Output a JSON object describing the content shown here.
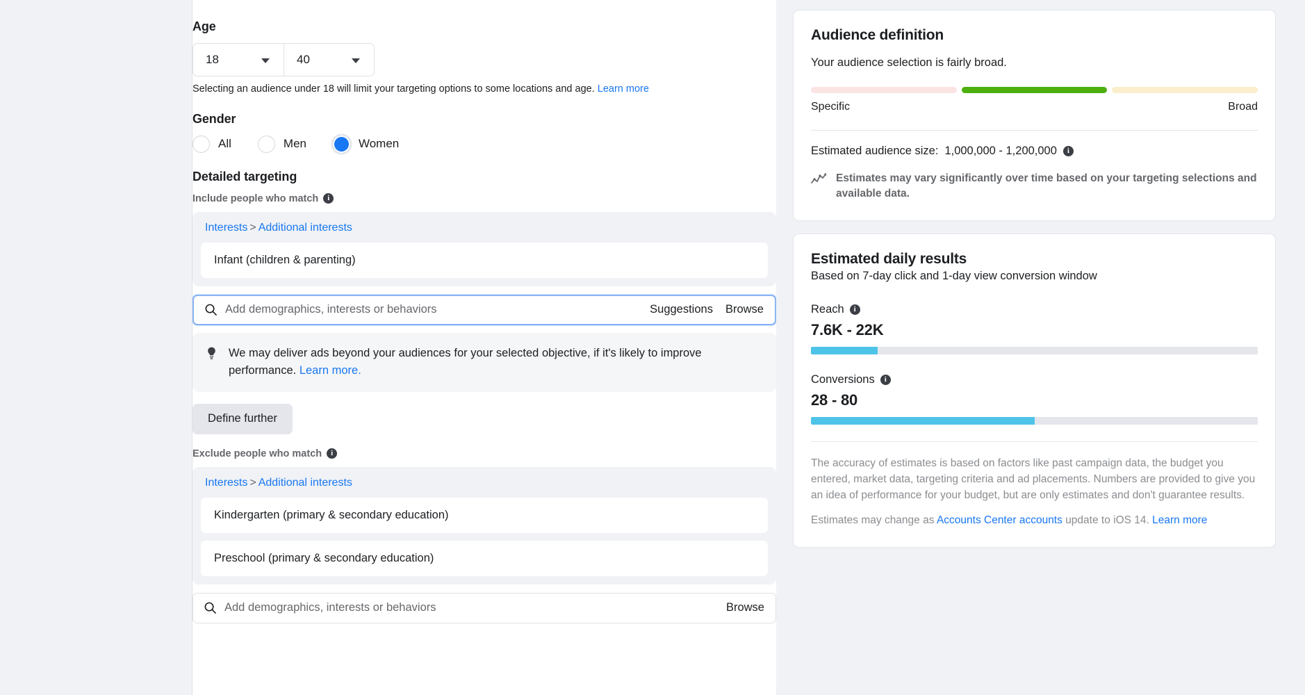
{
  "age": {
    "title": "Age",
    "min": "18",
    "max": "40",
    "helper_text": "Selecting an audience under 18 will limit your targeting options to some locations and age.",
    "helper_link": "Learn more"
  },
  "gender": {
    "title": "Gender",
    "options": [
      {
        "label": "All",
        "selected": false
      },
      {
        "label": "Men",
        "selected": false
      },
      {
        "label": "Women",
        "selected": true
      }
    ]
  },
  "detailed_targeting": {
    "title": "Detailed targeting",
    "include": {
      "label": "Include people who match",
      "breadcrumb_root": "Interests",
      "breadcrumb_sep": ">",
      "breadcrumb_leaf": "Additional interests",
      "items": [
        "Infant (children & parenting)"
      ],
      "search_placeholder": "Add demographics, interests or behaviors",
      "search_value": "",
      "action_suggestions": "Suggestions",
      "action_browse": "Browse"
    },
    "notice": {
      "text": "We may deliver ads beyond your audiences for your selected objective, if it's likely to improve performance.",
      "link": "Learn more."
    },
    "define_further": "Define further",
    "exclude": {
      "label": "Exclude people who match",
      "breadcrumb_root": "Interests",
      "breadcrumb_sep": ">",
      "breadcrumb_leaf": "Additional interests",
      "items": [
        "Kindergarten (primary & secondary education)",
        "Preschool (primary & secondary education)"
      ],
      "search_placeholder": "Add demographics, interests or behaviors",
      "search_value": "",
      "action_browse": "Browse"
    }
  },
  "audience_definition": {
    "title": "Audience definition",
    "subtitle": "Your audience selection is fairly broad.",
    "meter": {
      "segments": [
        {
          "color": "#fbe4e4",
          "active": false
        },
        {
          "color": "#4caf0e",
          "active": true
        },
        {
          "color": "#faeecd",
          "active": false
        }
      ],
      "left_label": "Specific",
      "right_label": "Broad"
    },
    "estimated_size_label": "Estimated audience size:",
    "estimated_size_value": "1,000,000 - 1,200,000",
    "vary_note": "Estimates may vary significantly over time based on your targeting selections and available data."
  },
  "estimated_daily_results": {
    "title": "Estimated daily results",
    "subtitle": "Based on 7-day click and 1-day view conversion window",
    "metrics": [
      {
        "label": "Reach",
        "value": "7.6K - 22K",
        "fill_percent": 15
      },
      {
        "label": "Conversions",
        "value": "28 - 80",
        "fill_percent": 50
      }
    ],
    "accuracy_note": "The accuracy of estimates is based on factors like past campaign data, the budget you entered, market data, targeting criteria and ad placements. Numbers are provided to give you an idea of performance for your budget, but are only estimates and don't guarantee results.",
    "ios_note_prefix": "Estimates may change as",
    "ios_note_link": "Accounts Center accounts",
    "ios_note_mid": "update to iOS 14.",
    "ios_note_link2": "Learn more"
  },
  "icons": {
    "info": "info-icon",
    "search": "search-icon",
    "bulb": "lightbulb-icon",
    "trend": "trend-chart-icon",
    "caret": "chevron-down-icon"
  }
}
